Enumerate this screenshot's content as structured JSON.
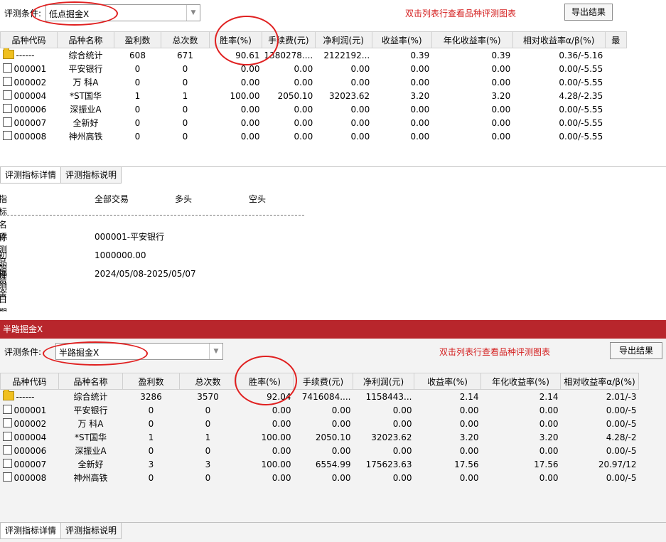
{
  "columns": [
    "品种代码",
    "品种名称",
    "盈利数",
    "总次数",
    "胜率(%)",
    "手续费(元)",
    "净利润(元)",
    "收益率(%)",
    "年化收益率(%)",
    "相对收益率α/β(%)",
    "最"
  ],
  "panel1": {
    "cond_label": "评测条件:",
    "cond_value": "低点掘金X",
    "hint": "双击列表行查看品种评测图表",
    "export_label": "导出结果",
    "rows": [
      {
        "code": "------",
        "name": "综合统计",
        "win": "608",
        "total": "671",
        "rate": "90.61",
        "fee": "1380278....",
        "profit": "2122192...",
        "ret": "0.39",
        "annual": "0.39",
        "rel": "0.36/-5.16",
        "icon": "folder"
      },
      {
        "code": "000001",
        "name": "平安银行",
        "win": "0",
        "total": "0",
        "rate": "0.00",
        "fee": "0.00",
        "profit": "0.00",
        "ret": "0.00",
        "annual": "0.00",
        "rel": "0.00/-5.55",
        "icon": "check"
      },
      {
        "code": "000002",
        "name": "万 科A",
        "win": "0",
        "total": "0",
        "rate": "0.00",
        "fee": "0.00",
        "profit": "0.00",
        "ret": "0.00",
        "annual": "0.00",
        "rel": "0.00/-5.55",
        "icon": "check"
      },
      {
        "code": "000004",
        "name": "*ST国华",
        "win": "1",
        "total": "1",
        "rate": "100.00",
        "fee": "2050.10",
        "profit": "32023.62",
        "ret": "3.20",
        "annual": "3.20",
        "rel": "4.28/-2.35",
        "icon": "check"
      },
      {
        "code": "000006",
        "name": "深振业A",
        "win": "0",
        "total": "0",
        "rate": "0.00",
        "fee": "0.00",
        "profit": "0.00",
        "ret": "0.00",
        "annual": "0.00",
        "rel": "0.00/-5.55",
        "icon": "check"
      },
      {
        "code": "000007",
        "name": "全新好",
        "win": "0",
        "total": "0",
        "rate": "0.00",
        "fee": "0.00",
        "profit": "0.00",
        "ret": "0.00",
        "annual": "0.00",
        "rel": "0.00/-5.55",
        "icon": "check"
      },
      {
        "code": "000008",
        "name": "神州高铁",
        "win": "0",
        "total": "0",
        "rate": "0.00",
        "fee": "0.00",
        "profit": "0.00",
        "ret": "0.00",
        "annual": "0.00",
        "rel": "0.00/-5.55",
        "icon": "check"
      }
    ],
    "tabs": [
      "评测指标详情",
      "评测指标说明"
    ],
    "detail": {
      "headers": [
        "指标名称",
        "全部交易",
        "多头",
        "空头"
      ],
      "items": [
        {
          "label": "评测品种",
          "value": "000001-平安银行"
        },
        {
          "label": "初始资金",
          "value": "1000000.00"
        },
        {
          "label": "评测日期",
          "value": "2024/05/08-2025/05/07"
        }
      ]
    }
  },
  "panel2": {
    "title": "半路掘金X",
    "cond_label": "评测条件:",
    "cond_value": "半路掘金X",
    "hint": "双击列表行查看品种评测图表",
    "export_label": "导出结果",
    "rows": [
      {
        "code": "------",
        "name": "综合统计",
        "win": "3286",
        "total": "3570",
        "rate": "92.04",
        "fee": "7416084....",
        "profit": "1158443...",
        "ret": "2.14",
        "annual": "2.14",
        "rel": "2.01/-3",
        "icon": "folder"
      },
      {
        "code": "000001",
        "name": "平安银行",
        "win": "0",
        "total": "0",
        "rate": "0.00",
        "fee": "0.00",
        "profit": "0.00",
        "ret": "0.00",
        "annual": "0.00",
        "rel": "0.00/-5",
        "icon": "check"
      },
      {
        "code": "000002",
        "name": "万 科A",
        "win": "0",
        "total": "0",
        "rate": "0.00",
        "fee": "0.00",
        "profit": "0.00",
        "ret": "0.00",
        "annual": "0.00",
        "rel": "0.00/-5",
        "icon": "check"
      },
      {
        "code": "000004",
        "name": "*ST国华",
        "win": "1",
        "total": "1",
        "rate": "100.00",
        "fee": "2050.10",
        "profit": "32023.62",
        "ret": "3.20",
        "annual": "3.20",
        "rel": "4.28/-2",
        "icon": "check"
      },
      {
        "code": "000006",
        "name": "深振业A",
        "win": "0",
        "total": "0",
        "rate": "0.00",
        "fee": "0.00",
        "profit": "0.00",
        "ret": "0.00",
        "annual": "0.00",
        "rel": "0.00/-5",
        "icon": "check"
      },
      {
        "code": "000007",
        "name": "全新好",
        "win": "3",
        "total": "3",
        "rate": "100.00",
        "fee": "6554.99",
        "profit": "175623.63",
        "ret": "17.56",
        "annual": "17.56",
        "rel": "20.97/12",
        "icon": "check"
      },
      {
        "code": "000008",
        "name": "神州高铁",
        "win": "0",
        "total": "0",
        "rate": "0.00",
        "fee": "0.00",
        "profit": "0.00",
        "ret": "0.00",
        "annual": "0.00",
        "rel": "0.00/-5",
        "icon": "check"
      }
    ],
    "tabs": [
      "评测指标详情",
      "评测指标说明"
    ]
  },
  "colors": {
    "titlebar": "#b8262c",
    "hint": "#d42020",
    "annotation": "#e02020"
  }
}
